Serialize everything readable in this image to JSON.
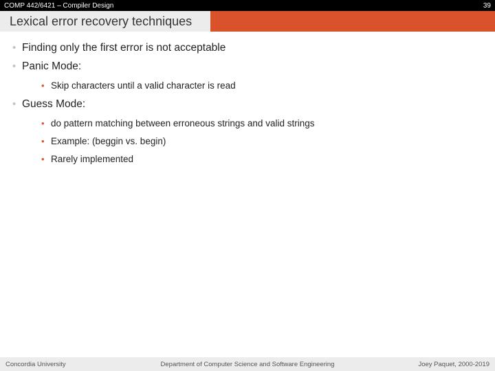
{
  "header": {
    "course": "COMP 442/6421 – Compiler Design",
    "slide_number": "39"
  },
  "title": "Lexical error recovery techniques",
  "bullets": [
    {
      "text": "Finding only the first error is not acceptable",
      "sub": []
    },
    {
      "text": "Panic Mode:",
      "sub": [
        {
          "text": "Skip characters until a valid character is read"
        }
      ]
    },
    {
      "text": "Guess Mode:",
      "sub": [
        {
          "text": "do pattern matching between erroneous strings and valid strings"
        },
        {
          "text": "Example: (beggin vs. begin)"
        },
        {
          "text": "Rarely implemented"
        }
      ]
    }
  ],
  "footer": {
    "left": "Concordia University",
    "center": "Department of Computer Science and Software Engineering",
    "right": "Joey Paquet, 2000-2019"
  }
}
